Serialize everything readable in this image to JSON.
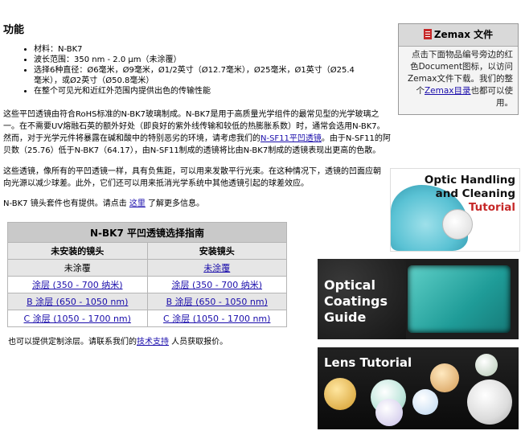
{
  "section_title": "功能",
  "features": [
    "材料：N-BK7",
    "波长范围：350 nm - 2.0 μm（未涂覆）",
    "选择6种直径：Ø6毫米，Ø9毫米，Ø1/2英寸（Ø12.7毫米），Ø25毫米，Ø1英寸（Ø25.4毫米），或Ø2英寸（Ø50.8毫米）",
    "在整个可见光和近红外范围内提供出色的传输性能"
  ],
  "paragraph1": {
    "text_a": "这些平凹透镜由符合RoHS标准的N-BK7玻璃制成。N-BK7是用于高质量光学组件的最常见型的光学玻璃之一。在不需要UV熔融石英的额外好处（即良好的紫外线传输和较低的热膨胀系数）时，通常会选用N-BK7。然而，对于光学元件将暴露在碱和酸中的特别恶劣的环境，请考虑我们的",
    "link": "N-SF11平凹透镜",
    "text_b": "。由于N-SF11的阿贝数（25.76）低于N-BK7（64.17），由N-SF11制成的透镜将比由N-BK7制成的透镜表现出更高的色散。"
  },
  "paragraph2": "这些透镜，像所有的平凹透镜一样，具有负焦距，可以用来发散平行光束。在这种情况下，透镜的凹面应朝向光源以减少球差。此外，它们还可以用来抵消光学系统中其他透镜引起的球差效应。",
  "paragraph3": {
    "text_a": "N-BK7 镜头套件也有提供。请点击 ",
    "link": "这里",
    "text_b": " 了解更多信息。"
  },
  "guide_table": {
    "title": "N-BK7 平凹透镜选择指南",
    "col_unmounted": "未安装的镜头",
    "col_mounted": "安装镜头",
    "rows": [
      {
        "unmounted": "未涂覆",
        "mounted": "未涂覆"
      },
      {
        "unmounted": "涂层 (350 - 700 纳米)",
        "mounted": "涂层 (350 - 700 纳米)"
      },
      {
        "unmounted": "B 涂层 (650 - 1050 nm)",
        "mounted": "B 涂层 (650 - 1050 nm)"
      },
      {
        "unmounted": "C 涂层 (1050 - 1700 nm)",
        "mounted": "C 涂层 (1050 - 1700 nm)"
      }
    ]
  },
  "paragraph4": {
    "text_a": "也可以提供定制涂层。请联系我们的",
    "link": "技术支持",
    "text_b": " 人员获取报价。"
  },
  "zemax": {
    "title": "Zemax 文件",
    "text_a": "点击下面物品编号旁边的红色Document图标，以访问Zemax文件下载。我们的整个",
    "link": "Zemax目录",
    "text_b": "也都可以使用。"
  },
  "banners": {
    "handling_line1": "Optic Handling",
    "handling_line2": "and Cleaning",
    "handling_line3": "Tutorial",
    "coatings_line1": "Optical",
    "coatings_line2": "Coatings",
    "coatings_line3": "Guide",
    "lens_tutorial": "Lens Tutorial"
  }
}
